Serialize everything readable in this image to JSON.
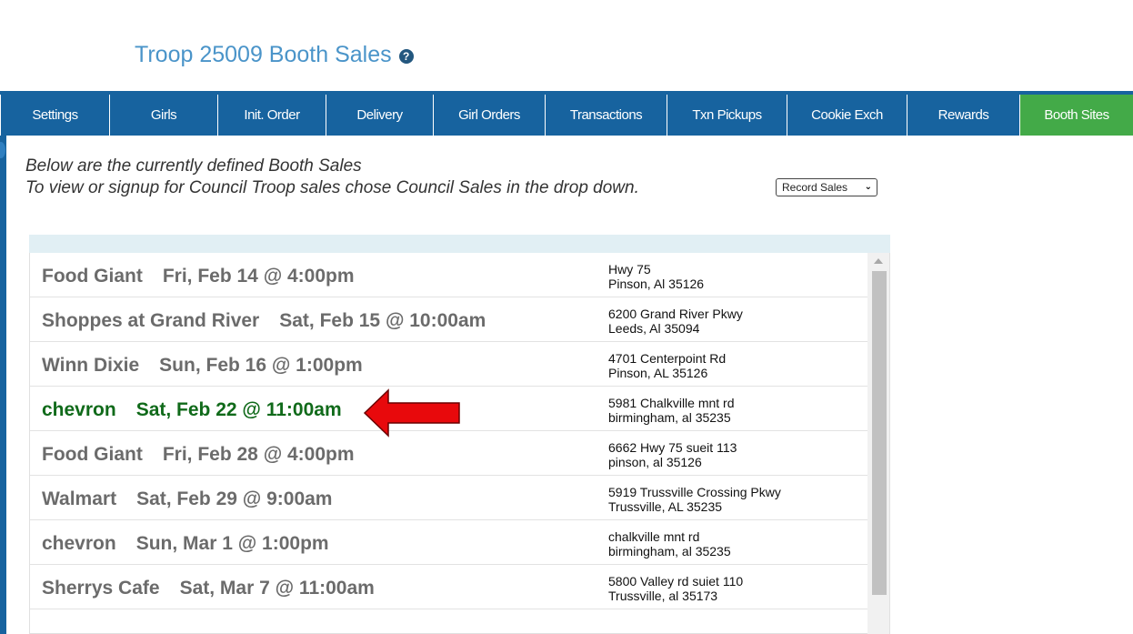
{
  "page": {
    "title": "Troop 25009 Booth Sales",
    "help_icon": "question-circle-icon"
  },
  "nav": {
    "items": [
      {
        "label": "Settings",
        "active": false
      },
      {
        "label": "Girls",
        "active": false
      },
      {
        "label": "Init. Order",
        "active": false
      },
      {
        "label": "Delivery",
        "active": false
      },
      {
        "label": "Girl Orders",
        "active": false
      },
      {
        "label": "Transactions",
        "active": false
      },
      {
        "label": "Txn Pickups",
        "active": false
      },
      {
        "label": "Cookie Exch",
        "active": false
      },
      {
        "label": "Rewards",
        "active": false
      },
      {
        "label": "Booth Sites",
        "active": true
      }
    ]
  },
  "intro": {
    "line1": "Below are the currently defined Booth Sales",
    "line2": "To view or signup for Council Troop sales chose Council Sales in the drop down."
  },
  "filter_select": {
    "value": "Record Sales"
  },
  "booths": [
    {
      "name": "Food Giant",
      "when": "Fri, Feb 14 @ 4:00pm",
      "addr1": "Hwy 75",
      "addr2": "Pinson, Al 35126",
      "highlighted": false
    },
    {
      "name": "Shoppes at Grand River",
      "when": "Sat, Feb 15 @ 10:00am",
      "addr1": "6200 Grand River Pkwy",
      "addr2": "Leeds, Al 35094",
      "highlighted": false
    },
    {
      "name": "Winn Dixie",
      "when": "Sun, Feb 16 @ 1:00pm",
      "addr1": "4701 Centerpoint Rd",
      "addr2": "Pinson, AL 35126",
      "highlighted": false
    },
    {
      "name": "chevron",
      "when": "Sat, Feb 22 @ 11:00am",
      "addr1": "5981 Chalkville mnt rd",
      "addr2": "birmingham, al 35235",
      "highlighted": true
    },
    {
      "name": "Food Giant",
      "when": "Fri, Feb 28 @ 4:00pm",
      "addr1": "6662 Hwy 75 sueit 113",
      "addr2": "pinson, al 35126",
      "highlighted": false
    },
    {
      "name": "Walmart",
      "when": "Sat, Feb 29 @ 9:00am",
      "addr1": "5919 Trussville Crossing Pkwy",
      "addr2": "Trussville, AL 35235",
      "highlighted": false
    },
    {
      "name": "chevron",
      "when": "Sun, Mar 1 @ 1:00pm",
      "addr1": "chalkville mnt rd",
      "addr2": "birmingham, al 35235",
      "highlighted": false
    },
    {
      "name": "Sherrys Cafe",
      "when": "Sat, Mar 7 @ 11:00am",
      "addr1": "5800 Valley rd suiet 110",
      "addr2": "Trussville, al 35173",
      "highlighted": false
    }
  ],
  "colors": {
    "nav_bg": "#17639f",
    "nav_active": "#43aa48",
    "highlight_text": "#106a1a",
    "arrow": "#e8090c"
  },
  "annotation": {
    "icon": "red-arrow-left-icon",
    "points_to_row": 3
  }
}
